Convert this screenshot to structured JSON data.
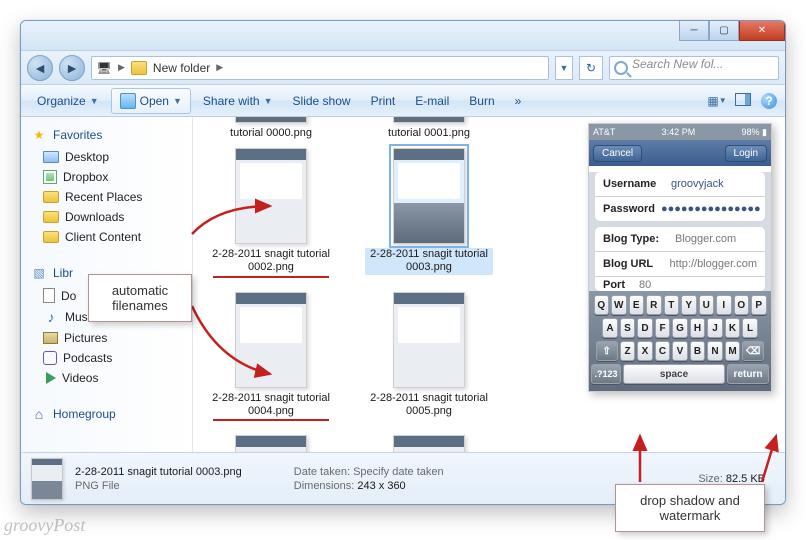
{
  "window": {
    "path_label": "New folder",
    "search_placeholder": "Search New fol..."
  },
  "toolbar": {
    "organize": "Organize",
    "open": "Open",
    "share": "Share with",
    "slideshow": "Slide show",
    "print": "Print",
    "email": "E-mail",
    "burn": "Burn",
    "more": "»"
  },
  "sidebar": {
    "favorites_label": "Favorites",
    "favorites": [
      {
        "icon": "desktop",
        "label": "Desktop"
      },
      {
        "icon": "box",
        "label": "Dropbox"
      },
      {
        "icon": "folder",
        "label": "Recent Places"
      },
      {
        "icon": "folder",
        "label": "Downloads"
      },
      {
        "icon": "folder",
        "label": "Client Content"
      }
    ],
    "libraries_label": "Libr",
    "libraries": [
      {
        "icon": "doc",
        "label": "Do"
      },
      {
        "icon": "music",
        "label": "Music"
      },
      {
        "icon": "pic",
        "label": "Pictures"
      },
      {
        "icon": "pod",
        "label": "Podcasts"
      },
      {
        "icon": "vid",
        "label": "Videos"
      }
    ],
    "homegroup_label": "Homegroup"
  },
  "files": {
    "row0": [
      "tutorial 0000.png",
      "tutorial 0001.png"
    ],
    "items": [
      {
        "name": "2-28-2011 snagit tutorial 0002.png",
        "underline": true
      },
      {
        "name": "2-28-2011 snagit tutorial 0003.png",
        "selected": true
      },
      {
        "name": "2-28-2011 snagit tutorial 0004.png",
        "underline": true
      },
      {
        "name": "2-28-2011 snagit tutorial 0005.png"
      }
    ]
  },
  "preview": {
    "carrier": "AT&T",
    "time": "3:42 PM",
    "battery": "98%",
    "cancel": "Cancel",
    "login": "Login",
    "fields": {
      "username_label": "Username",
      "username_value": "groovyjack",
      "password_label": "Password",
      "password_value": "●●●●●●●●●●●●●●●",
      "blogtype_label": "Blog Type:",
      "blogtype_value": "Blogger.com",
      "blogurl_label": "Blog URL",
      "blogurl_value": "http://blogger.com",
      "port_label": "Port",
      "port_value": "80"
    },
    "keys": {
      "r1": [
        "Q",
        "W",
        "E",
        "R",
        "T",
        "Y",
        "U",
        "I",
        "O",
        "P"
      ],
      "r2": [
        "A",
        "S",
        "D",
        "F",
        "G",
        "H",
        "J",
        "K",
        "L"
      ],
      "r3_shift": "⇧",
      "r3": [
        "Z",
        "X",
        "C",
        "V",
        "B",
        "N",
        "M"
      ],
      "r3_del": "⌫",
      "r4_num": ".?123",
      "r4_space": "space",
      "r4_return": "return"
    }
  },
  "details": {
    "name": "2-28-2011 snagit tutorial 0003.png",
    "type": "PNG File",
    "date_label": "Date taken:",
    "date_value": "Specify date taken",
    "dim_label": "Dimensions:",
    "dim_value": "243 x 360",
    "size_label": "Size:",
    "size_value": "82.5 KB"
  },
  "annotations": {
    "filenames": "automatic\nfilenames",
    "shadow": "drop shadow and\nwatermark"
  },
  "watermark": "groovyPost"
}
